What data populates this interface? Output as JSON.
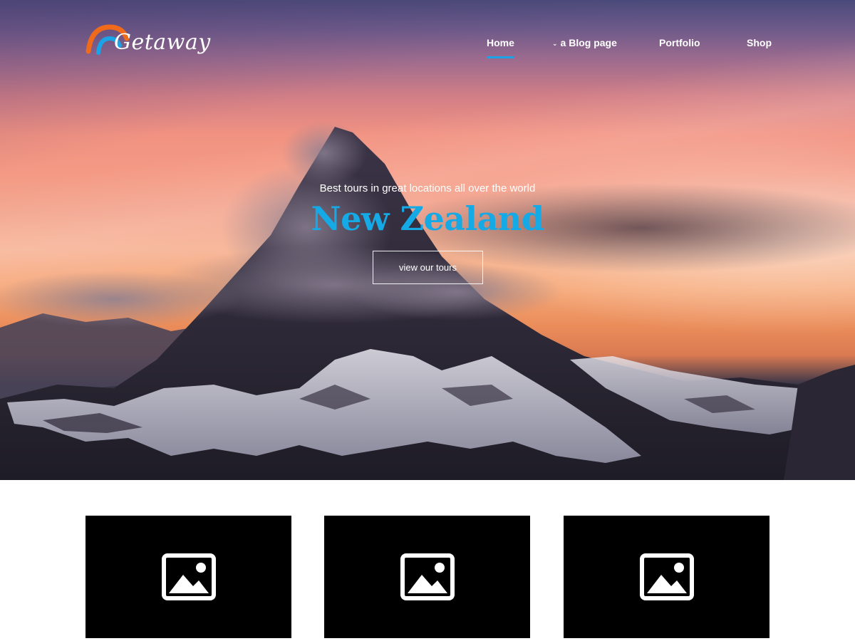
{
  "header": {
    "logo_text": "Getaway",
    "nav": [
      {
        "label": "Home",
        "active": true,
        "has_dropdown": false
      },
      {
        "label": "a Blog page",
        "active": false,
        "has_dropdown": true
      },
      {
        "label": "Portfolio",
        "active": false,
        "has_dropdown": false
      },
      {
        "label": "Shop",
        "active": false,
        "has_dropdown": false
      }
    ]
  },
  "hero": {
    "tagline": "Best tours in great locations all over the world",
    "title": "New Zealand",
    "cta_label": "view our tours"
  },
  "cards": [
    {
      "icon": "image-placeholder-icon"
    },
    {
      "icon": "image-placeholder-icon"
    },
    {
      "icon": "image-placeholder-icon"
    }
  ],
  "colors": {
    "accent": "#15a9e6",
    "logo_orange": "#f06a1c",
    "logo_blue": "#1aa3e6",
    "card_background": "#000000"
  }
}
